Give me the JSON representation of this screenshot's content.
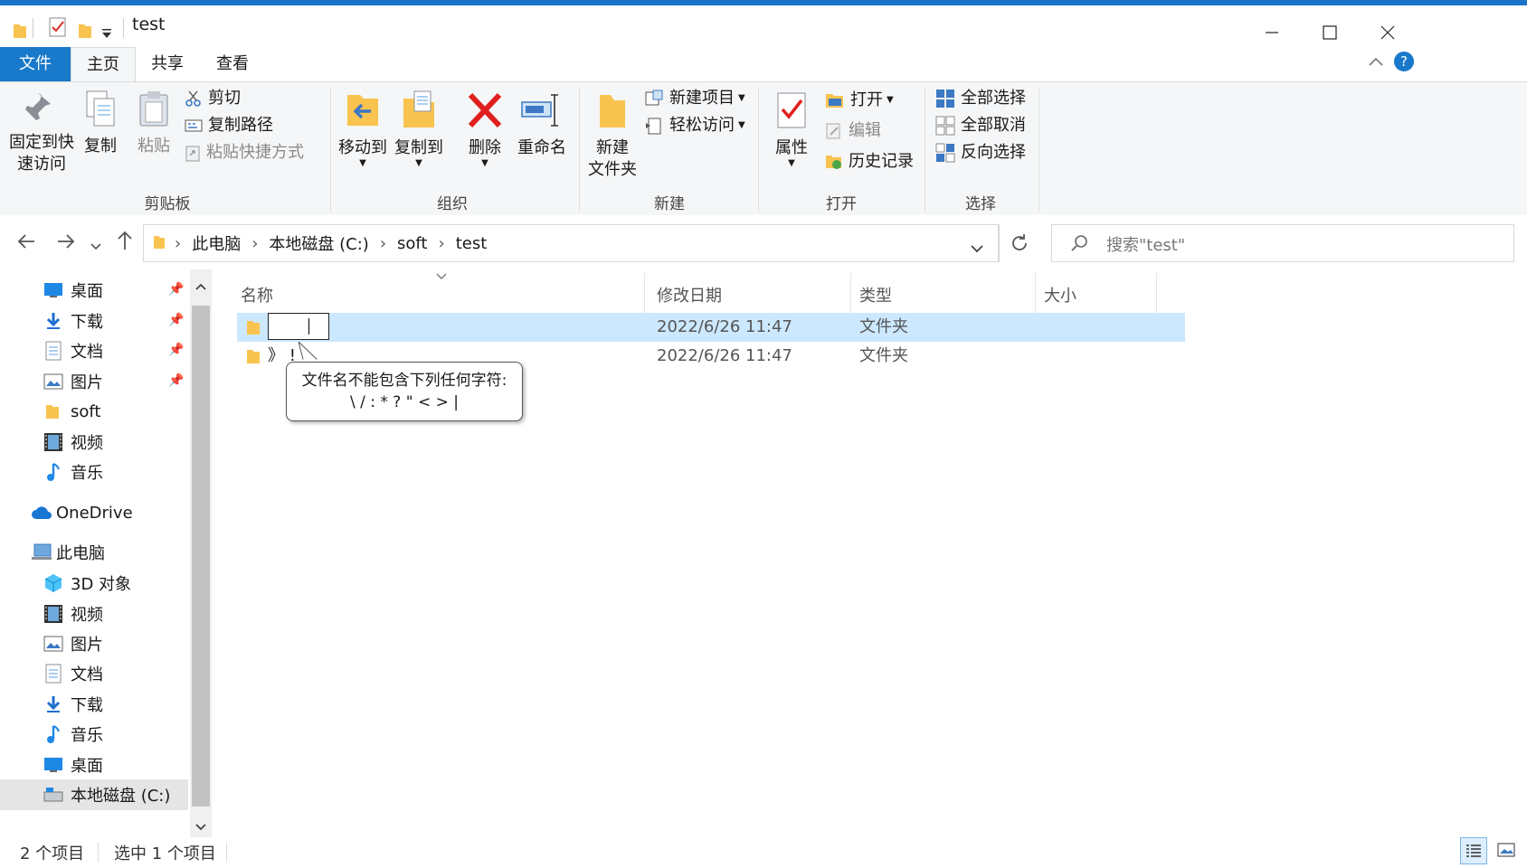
{
  "window": {
    "title": "test"
  },
  "ribbon_tabs": [
    "文件",
    "主页",
    "共享",
    "查看"
  ],
  "ribbon": {
    "clipboard": {
      "label": "剪贴板",
      "pin_line1": "固定到快",
      "pin_line2": "速访问",
      "copy": "复制",
      "paste": "粘贴",
      "cut": "剪切",
      "copy_path": "复制路径",
      "paste_shortcut": "粘贴快捷方式"
    },
    "organize": {
      "label": "组织",
      "move_to": "移动到",
      "copy_to": "复制到",
      "delete": "删除",
      "rename": "重命名"
    },
    "new": {
      "label": "新建",
      "new_folder_line1": "新建",
      "new_folder_line2": "文件夹",
      "new_item": "新建项目",
      "easy_access": "轻松访问"
    },
    "open": {
      "label": "打开",
      "properties": "属性",
      "open": "打开",
      "edit": "编辑",
      "history": "历史记录"
    },
    "select": {
      "label": "选择",
      "select_all": "全部选择",
      "select_none": "全部取消",
      "invert": "反向选择"
    }
  },
  "address": {
    "breadcrumbs": [
      "此电脑",
      "本地磁盘 (C:)",
      "soft",
      "test"
    ],
    "search_placeholder": "搜索\"test\""
  },
  "nav": {
    "quick_access": [
      {
        "label": "桌面",
        "icon": "desktop-icon",
        "pinned": true
      },
      {
        "label": "下载",
        "icon": "download-icon",
        "pinned": true
      },
      {
        "label": "文档",
        "icon": "document-icon",
        "pinned": true
      },
      {
        "label": "图片",
        "icon": "picture-icon",
        "pinned": true
      },
      {
        "label": "soft",
        "icon": "folder-icon",
        "pinned": false
      },
      {
        "label": "视频",
        "icon": "video-icon",
        "pinned": false
      },
      {
        "label": "音乐",
        "icon": "music-icon",
        "pinned": false
      }
    ],
    "onedrive": "OneDrive",
    "this_pc": "此电脑",
    "pc_items": [
      {
        "label": "3D 对象",
        "icon": "3d-objects-icon"
      },
      {
        "label": "视频",
        "icon": "video-icon"
      },
      {
        "label": "图片",
        "icon": "picture-icon"
      },
      {
        "label": "文档",
        "icon": "document-icon"
      },
      {
        "label": "下载",
        "icon": "download-icon"
      },
      {
        "label": "音乐",
        "icon": "music-icon"
      },
      {
        "label": "桌面",
        "icon": "desktop-icon"
      },
      {
        "label": "本地磁盘 (C:)",
        "icon": "drive-icon"
      }
    ]
  },
  "columns": [
    "名称",
    "修改日期",
    "类型",
    "大小"
  ],
  "files": [
    {
      "name": "",
      "modified": "2022/6/26 11:47",
      "type": "文件夹",
      "size": "",
      "selected": true,
      "renaming": true
    },
    {
      "name": "》 !",
      "modified": "2022/6/26 11:47",
      "type": "文件夹",
      "size": "",
      "selected": false
    }
  ],
  "tooltip": {
    "line1": "文件名不能包含下列任何字符:",
    "line2": "\\ / : * ? \" < > |"
  },
  "status": {
    "item_count": "2 个项目",
    "selected": "选中 1 个项目"
  },
  "colors": {
    "accent": "#1979ca",
    "selection": "#cce8ff",
    "folder": "#f8c44f"
  }
}
